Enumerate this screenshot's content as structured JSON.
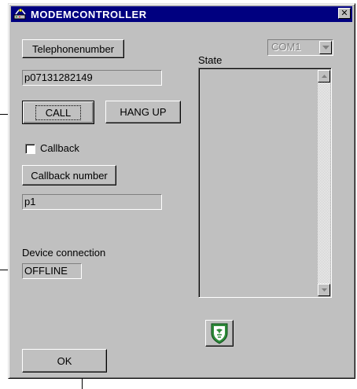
{
  "window": {
    "title": "MODEMCONTROLLER",
    "close_glyph": "✕"
  },
  "telephone": {
    "button_label": "Telephonenumber",
    "value": "p07131282149"
  },
  "call": {
    "call_label": "CALL",
    "hangup_label": "HANG UP"
  },
  "callback": {
    "checkbox_label": "Callback",
    "checked": false,
    "button_label": "Callback number",
    "value": "p1"
  },
  "device": {
    "label": "Device connection",
    "status": "OFFLINE"
  },
  "state": {
    "label": "State",
    "port_selected": "COM1"
  },
  "footer": {
    "ok_label": "OK"
  },
  "icons": {
    "app": "modem-app-icon",
    "close": "close-icon",
    "dropdown": "dropdown-arrow-icon",
    "scroll_up": "scroll-up-arrow-icon",
    "scroll_down": "scroll-down-arrow-icon",
    "logo": "shield-logo-icon"
  },
  "colors": {
    "titlebar": "#000080",
    "face": "#c0c0c0",
    "logo_green": "#2e8b3a"
  }
}
